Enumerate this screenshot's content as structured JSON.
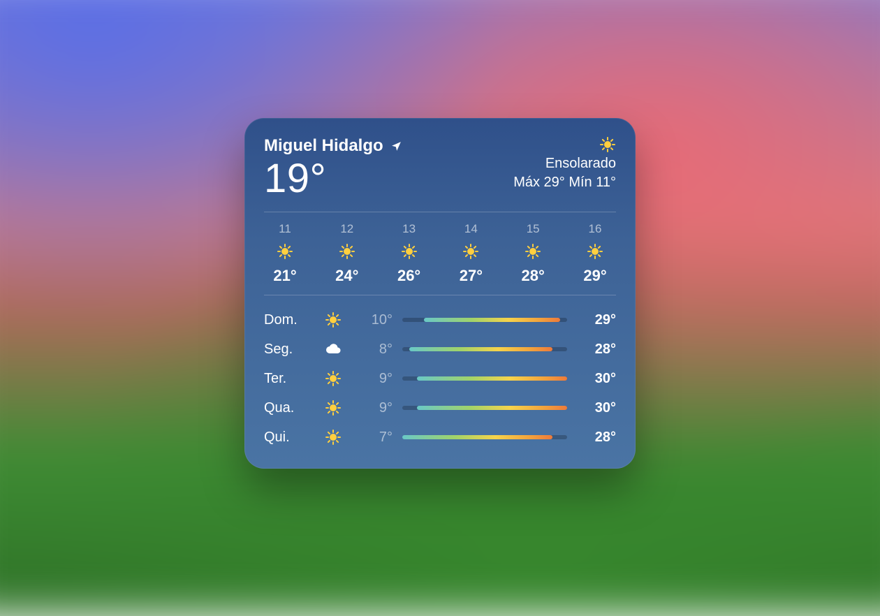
{
  "location": "Miguel Hidalgo",
  "current_temp": "19°",
  "condition": "Ensolarado",
  "range_text": "Máx 29° Mín 11°",
  "hourly": [
    {
      "hour": "11",
      "temp": "21°",
      "icon": "sun"
    },
    {
      "hour": "12",
      "temp": "24°",
      "icon": "sun"
    },
    {
      "hour": "13",
      "temp": "26°",
      "icon": "sun"
    },
    {
      "hour": "14",
      "temp": "27°",
      "icon": "sun"
    },
    {
      "hour": "15",
      "temp": "28°",
      "icon": "sun"
    },
    {
      "hour": "16",
      "temp": "29°",
      "icon": "sun"
    }
  ],
  "daily": [
    {
      "day": "Dom.",
      "icon": "sun",
      "low": "10°",
      "high": "29°",
      "low_v": 10,
      "high_v": 29
    },
    {
      "day": "Seg.",
      "icon": "cloud",
      "low": "8°",
      "high": "28°",
      "low_v": 8,
      "high_v": 28
    },
    {
      "day": "Ter.",
      "icon": "sun",
      "low": "9°",
      "high": "30°",
      "low_v": 9,
      "high_v": 30
    },
    {
      "day": "Qua.",
      "icon": "sun",
      "low": "9°",
      "high": "30°",
      "low_v": 9,
      "high_v": 30
    },
    {
      "day": "Qui.",
      "icon": "sun",
      "low": "7°",
      "high": "28°",
      "low_v": 7,
      "high_v": 28
    }
  ],
  "global_low": 7,
  "global_high": 30
}
